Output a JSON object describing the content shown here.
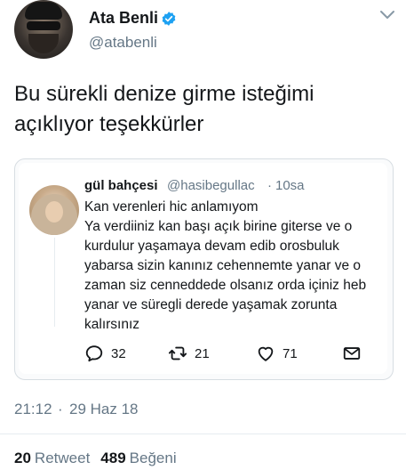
{
  "author": {
    "name": "Ata Benli",
    "handle": "@atabenli"
  },
  "tweet": {
    "text": "Bu sürekli denize girme isteğimi açıklıyor teşekkürler"
  },
  "quoted_tweet": {
    "name": "gül bahçesi",
    "handle": "@hasibegullac",
    "separator": "·",
    "time": "10sa",
    "lines": [
      "Kan verenleri hic anlamıyom",
      "Ya verdiiniz kan başı açık birine giterse ve o",
      "kurdulur yaşamaya devam edib orosbuluk",
      "yabarsa sizin kanınız cehennemte yanar ve o",
      "zaman siz cenneddede olsanız orda içiniz heb",
      "yanar ve süregli derede yaşamak zorunta",
      "kalırsınız"
    ],
    "actions": {
      "replies": "32",
      "retweets": "21",
      "likes": "71"
    }
  },
  "meta": {
    "time": "21:12",
    "separator": "·",
    "date": "29 Haz 18"
  },
  "stats": {
    "retweets_count": "20",
    "retweets_label": "Retweet",
    "likes_count": "489",
    "likes_label": "Beğeni"
  },
  "colors": {
    "verified": "#1da1f2",
    "secondary_text": "#657786",
    "primary_text": "#14171a",
    "border": "#d7dde2"
  },
  "icons": {
    "verified": "verified-badge-icon",
    "menu": "chevron-down-icon",
    "reply": "reply-icon",
    "retweet": "retweet-icon",
    "like": "heart-icon",
    "dm": "envelope-icon"
  }
}
